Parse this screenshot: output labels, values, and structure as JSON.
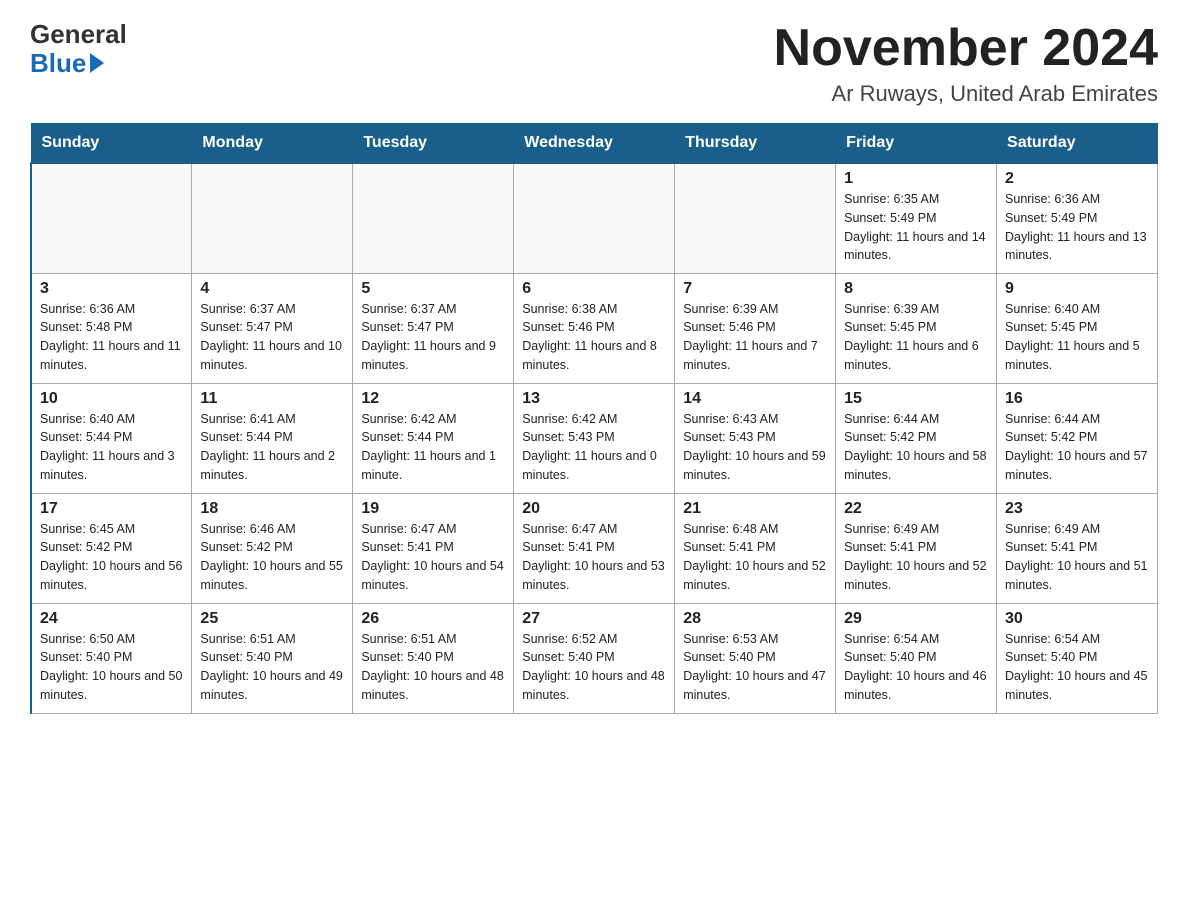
{
  "header": {
    "logo_general": "General",
    "logo_blue": "Blue",
    "month_title": "November 2024",
    "location": "Ar Ruways, United Arab Emirates"
  },
  "days_of_week": [
    "Sunday",
    "Monday",
    "Tuesday",
    "Wednesday",
    "Thursday",
    "Friday",
    "Saturday"
  ],
  "weeks": [
    [
      {
        "day": "",
        "sunrise": "",
        "sunset": "",
        "daylight": ""
      },
      {
        "day": "",
        "sunrise": "",
        "sunset": "",
        "daylight": ""
      },
      {
        "day": "",
        "sunrise": "",
        "sunset": "",
        "daylight": ""
      },
      {
        "day": "",
        "sunrise": "",
        "sunset": "",
        "daylight": ""
      },
      {
        "day": "",
        "sunrise": "",
        "sunset": "",
        "daylight": ""
      },
      {
        "day": "1",
        "sunrise": "Sunrise: 6:35 AM",
        "sunset": "Sunset: 5:49 PM",
        "daylight": "Daylight: 11 hours and 14 minutes."
      },
      {
        "day": "2",
        "sunrise": "Sunrise: 6:36 AM",
        "sunset": "Sunset: 5:49 PM",
        "daylight": "Daylight: 11 hours and 13 minutes."
      }
    ],
    [
      {
        "day": "3",
        "sunrise": "Sunrise: 6:36 AM",
        "sunset": "Sunset: 5:48 PM",
        "daylight": "Daylight: 11 hours and 11 minutes."
      },
      {
        "day": "4",
        "sunrise": "Sunrise: 6:37 AM",
        "sunset": "Sunset: 5:47 PM",
        "daylight": "Daylight: 11 hours and 10 minutes."
      },
      {
        "day": "5",
        "sunrise": "Sunrise: 6:37 AM",
        "sunset": "Sunset: 5:47 PM",
        "daylight": "Daylight: 11 hours and 9 minutes."
      },
      {
        "day": "6",
        "sunrise": "Sunrise: 6:38 AM",
        "sunset": "Sunset: 5:46 PM",
        "daylight": "Daylight: 11 hours and 8 minutes."
      },
      {
        "day": "7",
        "sunrise": "Sunrise: 6:39 AM",
        "sunset": "Sunset: 5:46 PM",
        "daylight": "Daylight: 11 hours and 7 minutes."
      },
      {
        "day": "8",
        "sunrise": "Sunrise: 6:39 AM",
        "sunset": "Sunset: 5:45 PM",
        "daylight": "Daylight: 11 hours and 6 minutes."
      },
      {
        "day": "9",
        "sunrise": "Sunrise: 6:40 AM",
        "sunset": "Sunset: 5:45 PM",
        "daylight": "Daylight: 11 hours and 5 minutes."
      }
    ],
    [
      {
        "day": "10",
        "sunrise": "Sunrise: 6:40 AM",
        "sunset": "Sunset: 5:44 PM",
        "daylight": "Daylight: 11 hours and 3 minutes."
      },
      {
        "day": "11",
        "sunrise": "Sunrise: 6:41 AM",
        "sunset": "Sunset: 5:44 PM",
        "daylight": "Daylight: 11 hours and 2 minutes."
      },
      {
        "day": "12",
        "sunrise": "Sunrise: 6:42 AM",
        "sunset": "Sunset: 5:44 PM",
        "daylight": "Daylight: 11 hours and 1 minute."
      },
      {
        "day": "13",
        "sunrise": "Sunrise: 6:42 AM",
        "sunset": "Sunset: 5:43 PM",
        "daylight": "Daylight: 11 hours and 0 minutes."
      },
      {
        "day": "14",
        "sunrise": "Sunrise: 6:43 AM",
        "sunset": "Sunset: 5:43 PM",
        "daylight": "Daylight: 10 hours and 59 minutes."
      },
      {
        "day": "15",
        "sunrise": "Sunrise: 6:44 AM",
        "sunset": "Sunset: 5:42 PM",
        "daylight": "Daylight: 10 hours and 58 minutes."
      },
      {
        "day": "16",
        "sunrise": "Sunrise: 6:44 AM",
        "sunset": "Sunset: 5:42 PM",
        "daylight": "Daylight: 10 hours and 57 minutes."
      }
    ],
    [
      {
        "day": "17",
        "sunrise": "Sunrise: 6:45 AM",
        "sunset": "Sunset: 5:42 PM",
        "daylight": "Daylight: 10 hours and 56 minutes."
      },
      {
        "day": "18",
        "sunrise": "Sunrise: 6:46 AM",
        "sunset": "Sunset: 5:42 PM",
        "daylight": "Daylight: 10 hours and 55 minutes."
      },
      {
        "day": "19",
        "sunrise": "Sunrise: 6:47 AM",
        "sunset": "Sunset: 5:41 PM",
        "daylight": "Daylight: 10 hours and 54 minutes."
      },
      {
        "day": "20",
        "sunrise": "Sunrise: 6:47 AM",
        "sunset": "Sunset: 5:41 PM",
        "daylight": "Daylight: 10 hours and 53 minutes."
      },
      {
        "day": "21",
        "sunrise": "Sunrise: 6:48 AM",
        "sunset": "Sunset: 5:41 PM",
        "daylight": "Daylight: 10 hours and 52 minutes."
      },
      {
        "day": "22",
        "sunrise": "Sunrise: 6:49 AM",
        "sunset": "Sunset: 5:41 PM",
        "daylight": "Daylight: 10 hours and 52 minutes."
      },
      {
        "day": "23",
        "sunrise": "Sunrise: 6:49 AM",
        "sunset": "Sunset: 5:41 PM",
        "daylight": "Daylight: 10 hours and 51 minutes."
      }
    ],
    [
      {
        "day": "24",
        "sunrise": "Sunrise: 6:50 AM",
        "sunset": "Sunset: 5:40 PM",
        "daylight": "Daylight: 10 hours and 50 minutes."
      },
      {
        "day": "25",
        "sunrise": "Sunrise: 6:51 AM",
        "sunset": "Sunset: 5:40 PM",
        "daylight": "Daylight: 10 hours and 49 minutes."
      },
      {
        "day": "26",
        "sunrise": "Sunrise: 6:51 AM",
        "sunset": "Sunset: 5:40 PM",
        "daylight": "Daylight: 10 hours and 48 minutes."
      },
      {
        "day": "27",
        "sunrise": "Sunrise: 6:52 AM",
        "sunset": "Sunset: 5:40 PM",
        "daylight": "Daylight: 10 hours and 48 minutes."
      },
      {
        "day": "28",
        "sunrise": "Sunrise: 6:53 AM",
        "sunset": "Sunset: 5:40 PM",
        "daylight": "Daylight: 10 hours and 47 minutes."
      },
      {
        "day": "29",
        "sunrise": "Sunrise: 6:54 AM",
        "sunset": "Sunset: 5:40 PM",
        "daylight": "Daylight: 10 hours and 46 minutes."
      },
      {
        "day": "30",
        "sunrise": "Sunrise: 6:54 AM",
        "sunset": "Sunset: 5:40 PM",
        "daylight": "Daylight: 10 hours and 45 minutes."
      }
    ]
  ]
}
